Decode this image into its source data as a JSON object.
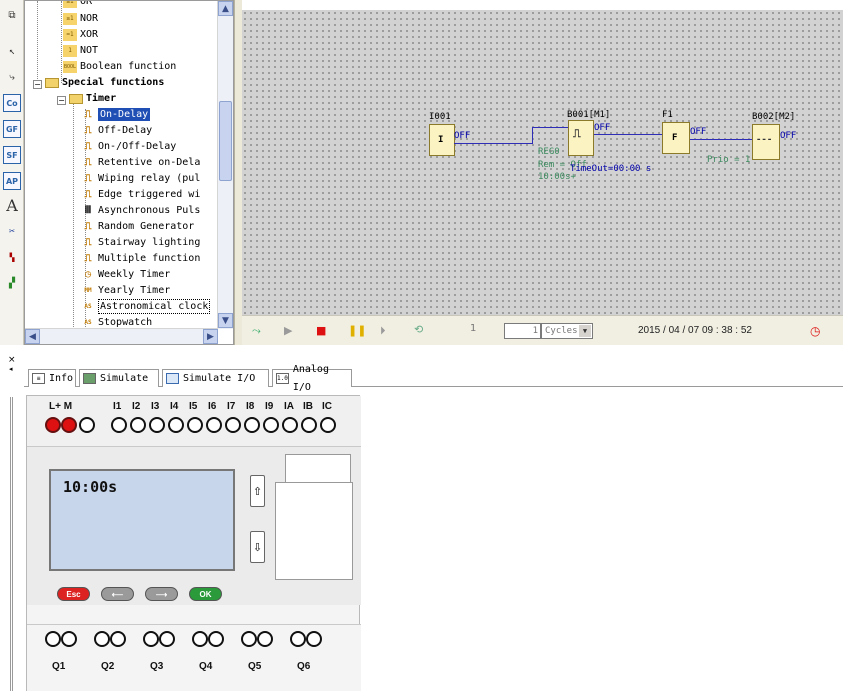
{
  "tree": {
    "items": [
      {
        "label": "OR",
        "icon_text": "≥1"
      },
      {
        "label": "NOR",
        "icon_text": "≥1"
      },
      {
        "label": "XOR",
        "icon_text": "=1"
      },
      {
        "label": "NOT",
        "icon_text": "1"
      },
      {
        "label": "Boolean function",
        "icon_text": "BOOL"
      },
      {
        "label": "Special functions"
      },
      {
        "label": "Timer"
      },
      {
        "label": "On-Delay"
      },
      {
        "label": "Off-Delay"
      },
      {
        "label": "On-/Off-Delay"
      },
      {
        "label": "Retentive on-Dela"
      },
      {
        "label": "Wiping relay (pul"
      },
      {
        "label": "Edge triggered wi"
      },
      {
        "label": "Asynchronous Puls"
      },
      {
        "label": "Random Generator"
      },
      {
        "label": "Stairway lighting"
      },
      {
        "label": "Multiple function"
      },
      {
        "label": "Weekly Timer"
      },
      {
        "label": "Yearly Timer"
      },
      {
        "label": "Astronomical clock"
      },
      {
        "label": "Stopwatch"
      }
    ]
  },
  "left_toolbar": {
    "co": "Co",
    "gf": "GF",
    "sf": "SF",
    "ap": "AP",
    "text_tool": "A"
  },
  "canvas": {
    "i001": {
      "name": "I001",
      "symbol": "I",
      "state": "OFF"
    },
    "b001": {
      "name": "B001[M1]",
      "state": "OFF",
      "param_reg": "REG0",
      "rem": "Rem = Off",
      "time": "10:00s+",
      "timeout": "TimeOut=00:00 s"
    },
    "f1": {
      "name": "F1",
      "symbol": "F",
      "state": "OFF",
      "prio": "Prio = 1"
    },
    "b002": {
      "name": "B002[M2]",
      "state": "OFF"
    }
  },
  "simbar": {
    "step_count": "1",
    "cycles_value": "1",
    "cycles_unit": "Cycles",
    "datetime": "2015 / 04 / 07 09 : 38 : 52"
  },
  "tabs": [
    "Info",
    "Simulate",
    "Simulate I/O",
    "Analog I/O"
  ],
  "tab_icons": {
    "analog": "1.0"
  },
  "device": {
    "power_label": "L+  M",
    "inputs": [
      "I1",
      "I2",
      "I3",
      "I4",
      "I5",
      "I6",
      "I7",
      "I8",
      "I9",
      "IA",
      "IB",
      "IC"
    ],
    "lcd_text": "10:00s",
    "keys": {
      "esc": "Esc",
      "ok": "OK"
    },
    "outputs": [
      "Q1",
      "Q2",
      "Q3",
      "Q4",
      "Q5",
      "Q6"
    ]
  },
  "colors": {
    "canvas_bg": "#d2d2d2",
    "wire": "#2d2db8",
    "block_fill": "#fbf3c2",
    "selection": "#1f4fb4",
    "lcd": "#c8d6ec",
    "power_led": "#d11111"
  }
}
